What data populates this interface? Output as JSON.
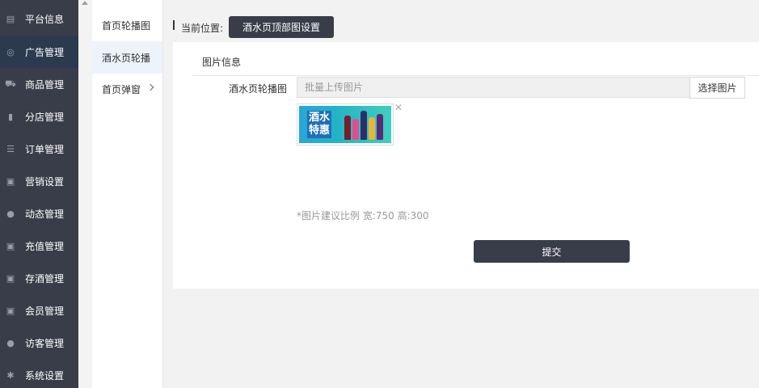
{
  "sidebar": {
    "items": [
      {
        "label": "平台信息",
        "icon": "newspaper-icon",
        "glyph": "▤"
      },
      {
        "label": "广告管理",
        "icon": "globe-icon",
        "glyph": "◎"
      },
      {
        "label": "商品管理",
        "icon": "cart-icon",
        "glyph": "⛟"
      },
      {
        "label": "分店管理",
        "icon": "building-icon",
        "glyph": "▮"
      },
      {
        "label": "订单管理",
        "icon": "list-icon",
        "glyph": "☰"
      },
      {
        "label": "营销设置",
        "icon": "gift-icon",
        "glyph": "▣"
      },
      {
        "label": "动态管理",
        "icon": "user-icon",
        "glyph": "●"
      },
      {
        "label": "充值管理",
        "icon": "gift-icon",
        "glyph": "▣"
      },
      {
        "label": "存酒管理",
        "icon": "gift-icon",
        "glyph": "▣"
      },
      {
        "label": "会员管理",
        "icon": "gift-icon",
        "glyph": "▣"
      },
      {
        "label": "访客管理",
        "icon": "user-icon",
        "glyph": "●"
      },
      {
        "label": "系统设置",
        "icon": "gear-icon",
        "glyph": "✱"
      }
    ],
    "active_index": 1
  },
  "submenu": {
    "items": [
      {
        "label": "首页轮播图"
      },
      {
        "label": "酒水页轮播"
      },
      {
        "label": "首页弹窗"
      }
    ],
    "active_index": 1
  },
  "breadcrumb": {
    "label": "当前位置:",
    "current": "酒水页顶部图设置"
  },
  "form": {
    "section_title": "图片信息",
    "field_label": "酒水页轮播图",
    "upload_placeholder": "批量上传图片",
    "choose_button": "选择图片",
    "thumbnail_text": "酒水特惠",
    "remove_glyph": "✕",
    "hint": "*图片建议比例 宽:750 高:300",
    "submit_button": "提交"
  },
  "colors": {
    "sidebar_bg": "#393d49",
    "sidebar_active": "#2b3a4f",
    "button_dark": "#393d49",
    "submenu_active": "#edf3fb"
  }
}
